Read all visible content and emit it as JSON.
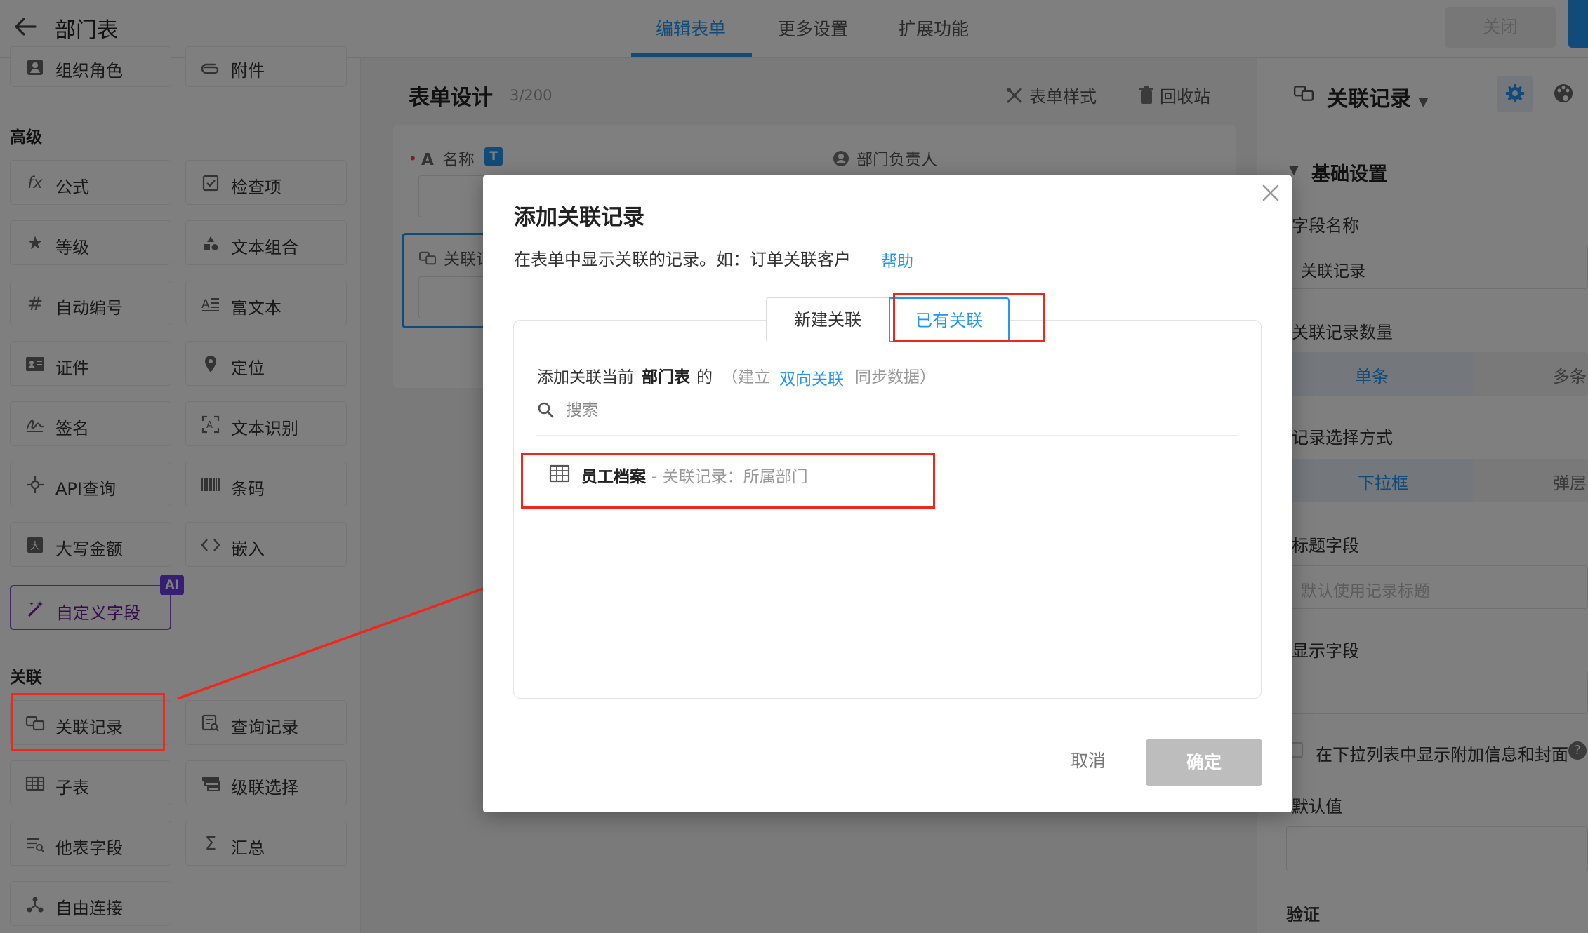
{
  "header": {
    "title": "部门表",
    "tabs": [
      {
        "label": "编辑表单",
        "active": true
      },
      {
        "label": "更多设置",
        "active": false
      },
      {
        "label": "扩展功能",
        "active": false
      }
    ],
    "close_label": "关闭"
  },
  "palette": {
    "top_items": [
      {
        "label": "组织角色",
        "icon": "org-role-icon"
      },
      {
        "label": "附件",
        "icon": "attachment-icon"
      }
    ],
    "advanced_title": "高级",
    "advanced_items": [
      {
        "label": "公式",
        "icon": "formula-icon"
      },
      {
        "label": "检查项",
        "icon": "checkbox-icon"
      },
      {
        "label": "等级",
        "icon": "star-icon"
      },
      {
        "label": "文本组合",
        "icon": "text-combine-icon"
      },
      {
        "label": "自动编号",
        "icon": "hash-icon"
      },
      {
        "label": "富文本",
        "icon": "rich-text-icon"
      },
      {
        "label": "证件",
        "icon": "id-card-icon"
      },
      {
        "label": "定位",
        "icon": "location-icon"
      },
      {
        "label": "签名",
        "icon": "signature-icon"
      },
      {
        "label": "文本识别",
        "icon": "ocr-icon"
      },
      {
        "label": "API查询",
        "icon": "api-icon"
      },
      {
        "label": "条码",
        "icon": "barcode-icon"
      },
      {
        "label": "大写金额",
        "icon": "amount-icon"
      },
      {
        "label": "嵌入",
        "icon": "embed-icon"
      }
    ],
    "custom_label": "自定义字段",
    "ai_badge": "AI",
    "relation_title": "关联",
    "relation_items": [
      {
        "label": "关联记录",
        "icon": "relation-record-icon"
      },
      {
        "label": "查询记录",
        "icon": "query-record-icon"
      },
      {
        "label": "子表",
        "icon": "subtable-icon"
      },
      {
        "label": "级联选择",
        "icon": "cascade-icon"
      },
      {
        "label": "他表字段",
        "icon": "other-table-field-icon"
      },
      {
        "label": "汇总",
        "icon": "sigma-icon"
      },
      {
        "label": "自由连接",
        "icon": "free-connect-icon"
      }
    ]
  },
  "form": {
    "title": "表单设计",
    "count": "3/200",
    "style_label": "表单样式",
    "recycle_label": "回收站",
    "field_name_label": "名称",
    "field_name_badge": "T",
    "field_head_label": "部门负责人",
    "field_relation_label": "关联记"
  },
  "right_panel": {
    "field_type": "关联记录",
    "section": "基础设置",
    "field_name_label": "字段名称",
    "field_name_value": "关联记录",
    "count_label": "关联记录数量",
    "count_options": [
      "单条",
      "多条"
    ],
    "select_mode_label": "记录选择方式",
    "select_mode_options": [
      "下拉框",
      "弹层"
    ],
    "title_field_label": "标题字段",
    "title_field_placeholder": "默认使用记录标题",
    "display_field_label": "显示字段",
    "extra_info_label": "在下拉列表中显示附加信息和封面",
    "default_label": "默认值",
    "validation_label": "验证"
  },
  "modal": {
    "title": "添加关联记录",
    "desc": "在表单中显示关联的记录。如：订单关联客户",
    "help": "帮助",
    "seg_new": "新建关联",
    "seg_existing": "已有关联",
    "line_prefix": "添加关联当前",
    "line_table": "部门表",
    "line_of": "的",
    "line_paren_open": "（建立",
    "line_link": "双向关联",
    "line_paren_close": "同步数据）",
    "search_placeholder": "搜索",
    "option_name": "员工档案",
    "option_detail": " - 关联记录：所属部门",
    "cancel": "取消",
    "ok": "确定"
  },
  "colors": {
    "accent": "#2196f3",
    "annotation": "#f0271c",
    "ai_purple": "#6a3de8"
  }
}
